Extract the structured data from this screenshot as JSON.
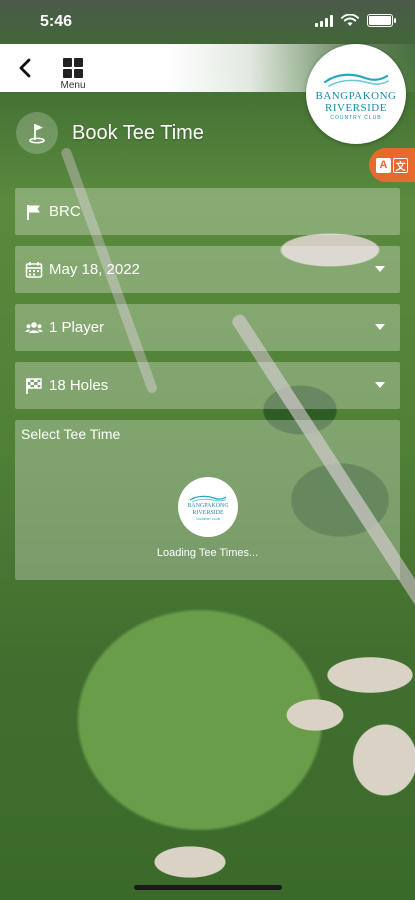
{
  "status_bar": {
    "time": "5:46"
  },
  "nav": {
    "menu_label": "Menu"
  },
  "logo": {
    "line1": "BANGPAKONG",
    "line2": "RIVERSIDE",
    "line3": "COUNTRY CLUB"
  },
  "header": {
    "title": "Book Tee Time"
  },
  "form": {
    "course": "BRC",
    "date": "May 18, 2022",
    "players": "1 Player",
    "holes": "18 Holes"
  },
  "tee_times": {
    "title": "Select Tee Time",
    "loading_text": "Loading Tee Times..."
  },
  "colors": {
    "accent": "#e8692e",
    "brand_teal": "#1b8ca6"
  }
}
